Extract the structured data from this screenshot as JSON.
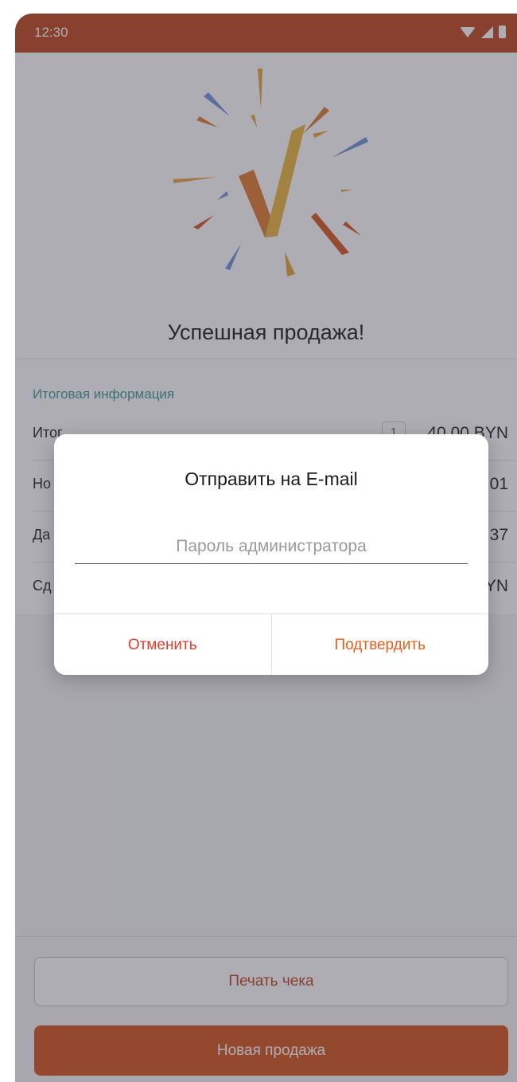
{
  "status_bar": {
    "time": "12:30"
  },
  "success": {
    "title": "Успешная продажа!"
  },
  "summary": {
    "section_title": "Итоговая информация",
    "rows": [
      {
        "label": "Итог",
        "value": "40.00 BYN",
        "badge": "1"
      },
      {
        "label": "Но",
        "value": "01"
      },
      {
        "label": "Да",
        "value": "37"
      },
      {
        "label": "Сд",
        "value": "YN"
      }
    ]
  },
  "dialog": {
    "title": "Отправить на E-mail",
    "input_placeholder": "Пароль администратора",
    "input_value": "",
    "cancel_label": "Отменить",
    "confirm_label": "Подтвердить"
  },
  "footer": {
    "print_label": "Печать чека",
    "new_sale_label": "Новая продажа"
  },
  "colors": {
    "brand": "#c0461b",
    "accent_orange": "#d4541c",
    "section_teal": "#3a9b8f",
    "cancel_red": "#e23c2c",
    "confirm_orange": "#e4611f"
  },
  "icons": [
    "wifi-icon",
    "signal-icon",
    "battery-icon",
    "success-check-illustration"
  ]
}
